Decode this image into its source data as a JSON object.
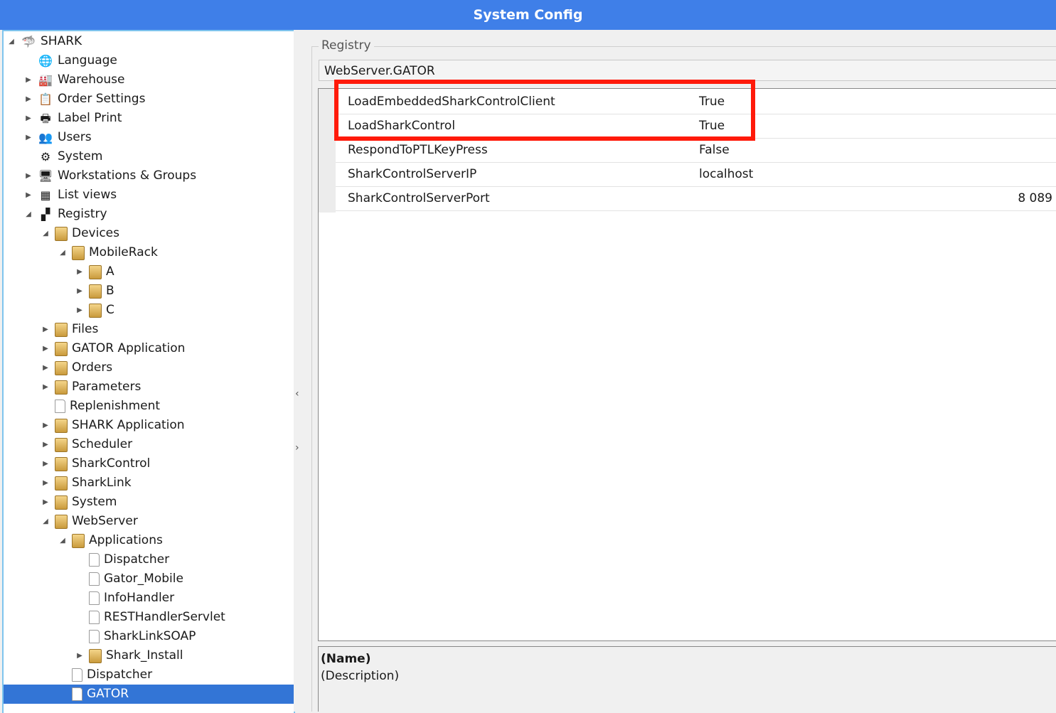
{
  "window": {
    "title": "System Config"
  },
  "tree": {
    "nodes": [
      {
        "label": "SHARK",
        "arrow": "◢",
        "icon": "shark-logo-icon",
        "glyph": "🦈",
        "level": 0
      },
      {
        "label": "Language",
        "arrow": "",
        "icon": "globe-icon",
        "glyph": "🌐",
        "level": 1
      },
      {
        "label": "Warehouse",
        "arrow": "▶",
        "icon": "factory-icon",
        "glyph": "🏭",
        "level": 1
      },
      {
        "label": "Order Settings",
        "arrow": "▶",
        "icon": "order-settings-icon",
        "glyph": "📋",
        "level": 1
      },
      {
        "label": "Label Print",
        "arrow": "▶",
        "icon": "printer-icon",
        "glyph": "🖶",
        "level": 1
      },
      {
        "label": "Users",
        "arrow": "▶",
        "icon": "users-icon",
        "glyph": "👥",
        "level": 1
      },
      {
        "label": "System",
        "arrow": "",
        "icon": "gears-icon",
        "glyph": "⚙",
        "level": 1
      },
      {
        "label": "Workstations & Groups",
        "arrow": "▶",
        "icon": "workstation-icon",
        "glyph": "🖥",
        "level": 1
      },
      {
        "label": "List views",
        "arrow": "▶",
        "icon": "table-icon",
        "glyph": "▦",
        "level": 1
      },
      {
        "label": "Registry",
        "arrow": "◢",
        "icon": "registry-icon",
        "glyph": "▞",
        "level": 1
      },
      {
        "label": "Devices",
        "arrow": "◢",
        "icon": "folder-icon",
        "glyph": "",
        "level": 2
      },
      {
        "label": "MobileRack",
        "arrow": "◢",
        "icon": "folder-icon",
        "glyph": "",
        "level": 3
      },
      {
        "label": "A",
        "arrow": "▶",
        "icon": "folder-icon",
        "glyph": "",
        "level": 4
      },
      {
        "label": "B",
        "arrow": "▶",
        "icon": "folder-icon",
        "glyph": "",
        "level": 4
      },
      {
        "label": "C",
        "arrow": "▶",
        "icon": "folder-icon",
        "glyph": "",
        "level": 4
      },
      {
        "label": "Files",
        "arrow": "▶",
        "icon": "folder-icon",
        "glyph": "",
        "level": 2
      },
      {
        "label": "GATOR Application",
        "arrow": "▶",
        "icon": "folder-icon",
        "glyph": "",
        "level": 2
      },
      {
        "label": "Orders",
        "arrow": "▶",
        "icon": "folder-icon",
        "glyph": "",
        "level": 2
      },
      {
        "label": "Parameters",
        "arrow": "▶",
        "icon": "folder-icon",
        "glyph": "",
        "level": 2
      },
      {
        "label": "Replenishment",
        "arrow": "",
        "icon": "document-icon",
        "glyph": "",
        "level": 2
      },
      {
        "label": "SHARK Application",
        "arrow": "▶",
        "icon": "folder-icon",
        "glyph": "",
        "level": 2
      },
      {
        "label": "Scheduler",
        "arrow": "▶",
        "icon": "folder-icon",
        "glyph": "",
        "level": 2
      },
      {
        "label": "SharkControl",
        "arrow": "▶",
        "icon": "folder-icon",
        "glyph": "",
        "level": 2
      },
      {
        "label": "SharkLink",
        "arrow": "▶",
        "icon": "folder-icon",
        "glyph": "",
        "level": 2
      },
      {
        "label": "System",
        "arrow": "▶",
        "icon": "folder-icon",
        "glyph": "",
        "level": 2
      },
      {
        "label": "WebServer",
        "arrow": "◢",
        "icon": "folder-icon",
        "glyph": "",
        "level": 2
      },
      {
        "label": "Applications",
        "arrow": "◢",
        "icon": "folder-icon",
        "glyph": "",
        "level": 3
      },
      {
        "label": "Dispatcher",
        "arrow": "",
        "icon": "document-icon",
        "glyph": "",
        "level": 4
      },
      {
        "label": "Gator_Mobile",
        "arrow": "",
        "icon": "document-icon",
        "glyph": "",
        "level": 4
      },
      {
        "label": "InfoHandler",
        "arrow": "",
        "icon": "document-icon",
        "glyph": "",
        "level": 4
      },
      {
        "label": "RESTHandlerServlet",
        "arrow": "",
        "icon": "document-icon",
        "glyph": "",
        "level": 4
      },
      {
        "label": "SharkLinkSOAP",
        "arrow": "",
        "icon": "document-icon",
        "glyph": "",
        "level": 4
      },
      {
        "label": "Shark_Install",
        "arrow": "▶",
        "icon": "folder-icon",
        "glyph": "",
        "level": 4
      },
      {
        "label": "Dispatcher",
        "arrow": "",
        "icon": "document-icon",
        "glyph": "",
        "level": 3
      },
      {
        "label": "GATOR",
        "arrow": "",
        "icon": "document-icon",
        "glyph": "",
        "level": 3,
        "selected": true
      }
    ]
  },
  "splitter": {
    "collapse_glyph": "‹",
    "expand_glyph": "›"
  },
  "registry": {
    "group_label": "Registry",
    "path": "WebServer.GATOR",
    "properties": [
      {
        "name": "LoadEmbeddedSharkControlClient",
        "value": "True",
        "numeric": false
      },
      {
        "name": "LoadSharkControl",
        "value": "True",
        "numeric": false
      },
      {
        "name": "RespondToPTLKeyPress",
        "value": "False",
        "numeric": false
      },
      {
        "name": "SharkControlServerIP",
        "value": "localhost",
        "numeric": false
      },
      {
        "name": "SharkControlServerPort",
        "value": "8 089",
        "numeric": true
      }
    ],
    "description": {
      "name": "(Name)",
      "text": "(Description)"
    }
  },
  "colors": {
    "titlebar": "#3f7fe8",
    "selection": "#3375d6",
    "highlight_box": "#ff1a0a",
    "tree_border": "#7ec4ee"
  }
}
